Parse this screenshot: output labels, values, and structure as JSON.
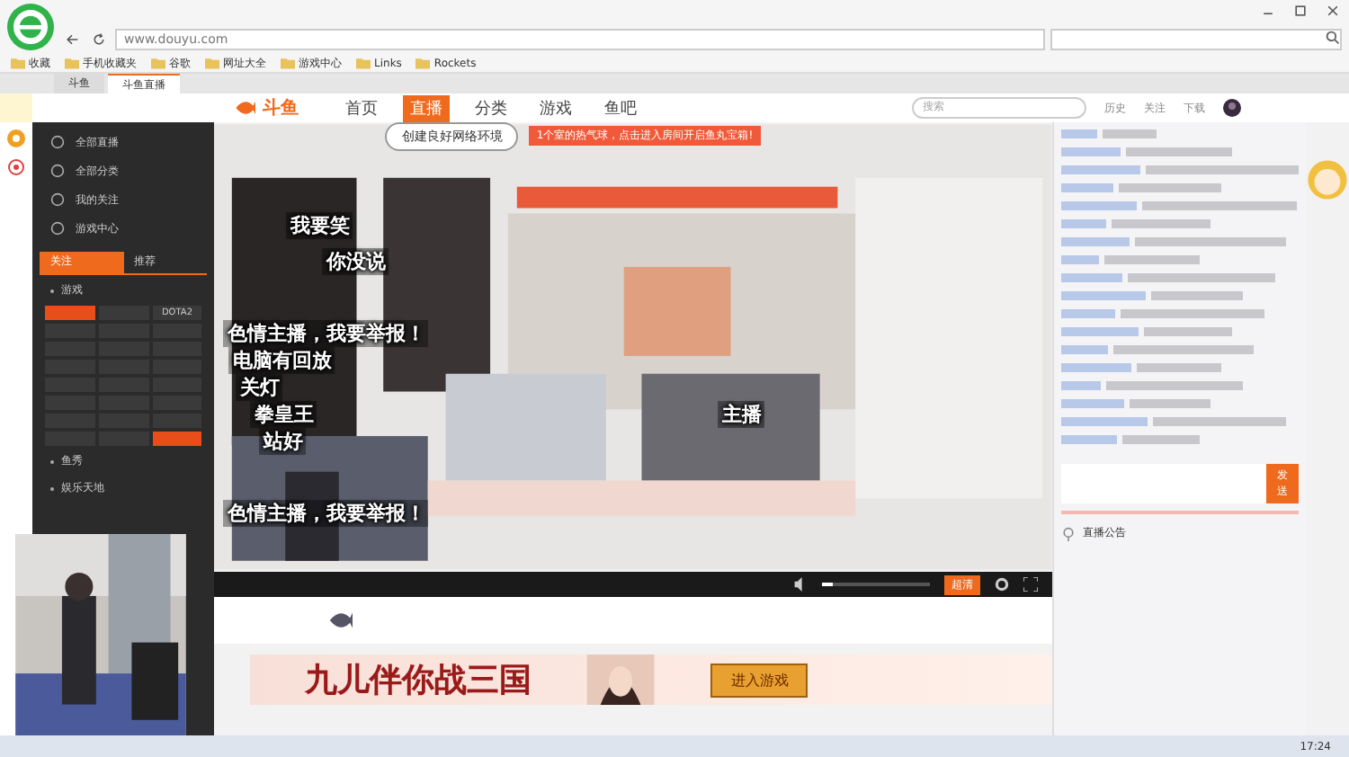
{
  "browser": {
    "url": "www.douyu.com",
    "tabs": [
      {
        "label": "斗鱼",
        "selected": false
      },
      {
        "label": "斗鱼直播",
        "selected": true
      }
    ],
    "bookmarks": [
      "收藏",
      "手机收藏夹",
      "谷歌",
      "网址大全",
      "游戏中心",
      "Links",
      "Rockets"
    ]
  },
  "site": {
    "logo": "斗鱼",
    "nav": [
      {
        "label": "首页",
        "selected": false
      },
      {
        "label": "直播",
        "selected": true
      },
      {
        "label": "分类",
        "selected": false
      },
      {
        "label": "游戏",
        "selected": false
      },
      {
        "label": "鱼吧",
        "selected": false
      }
    ],
    "search_placeholder": "搜索",
    "actions": [
      "历史",
      "关注",
      "下载"
    ]
  },
  "sidebar": {
    "items": [
      "全部直播",
      "全部分类",
      "我的关注",
      "游戏中心"
    ],
    "tabs": [
      {
        "label": "关注",
        "selected": true
      },
      {
        "label": "推荐",
        "selected": false
      }
    ],
    "sections": [
      "游戏",
      "鱼秀",
      "娱乐天地"
    ],
    "chips": [
      {
        "selected": true
      },
      {
        "selected": false
      },
      {
        "label": "DOTA2",
        "selected": false
      },
      {
        "selected": false
      },
      {
        "selected": false
      },
      {
        "selected": false
      },
      {
        "selected": false
      },
      {
        "selected": false
      },
      {
        "selected": false
      },
      {
        "selected": false
      },
      {
        "selected": false
      },
      {
        "selected": false
      },
      {
        "selected": false
      },
      {
        "selected": false
      },
      {
        "selected": false
      },
      {
        "selected": false
      },
      {
        "selected": false
      },
      {
        "selected": false
      },
      {
        "selected": false
      },
      {
        "selected": false
      },
      {
        "selected": false
      },
      {
        "selected": false
      },
      {
        "selected": false
      },
      {
        "selected": true
      }
    ]
  },
  "video": {
    "bubble": "创建良好网络环境",
    "ticker": "1个室的热气球，点击进入房间开启鱼丸宝箱!",
    "danmaku": [
      "我要笑",
      "你没说",
      "色情主播，我要举报！",
      "电脑有回放",
      "关灯",
      "拳皇王",
      "站好",
      "主播",
      "色情主播，我要举报！"
    ],
    "controls": {
      "level": 0.1,
      "quality": "超清"
    }
  },
  "banner": {
    "title": "九儿伴你战三国",
    "button": "进入游戏"
  },
  "chat": {
    "send": "发送",
    "notice": "直播公告"
  },
  "taskbar": {
    "time": "17:24"
  }
}
